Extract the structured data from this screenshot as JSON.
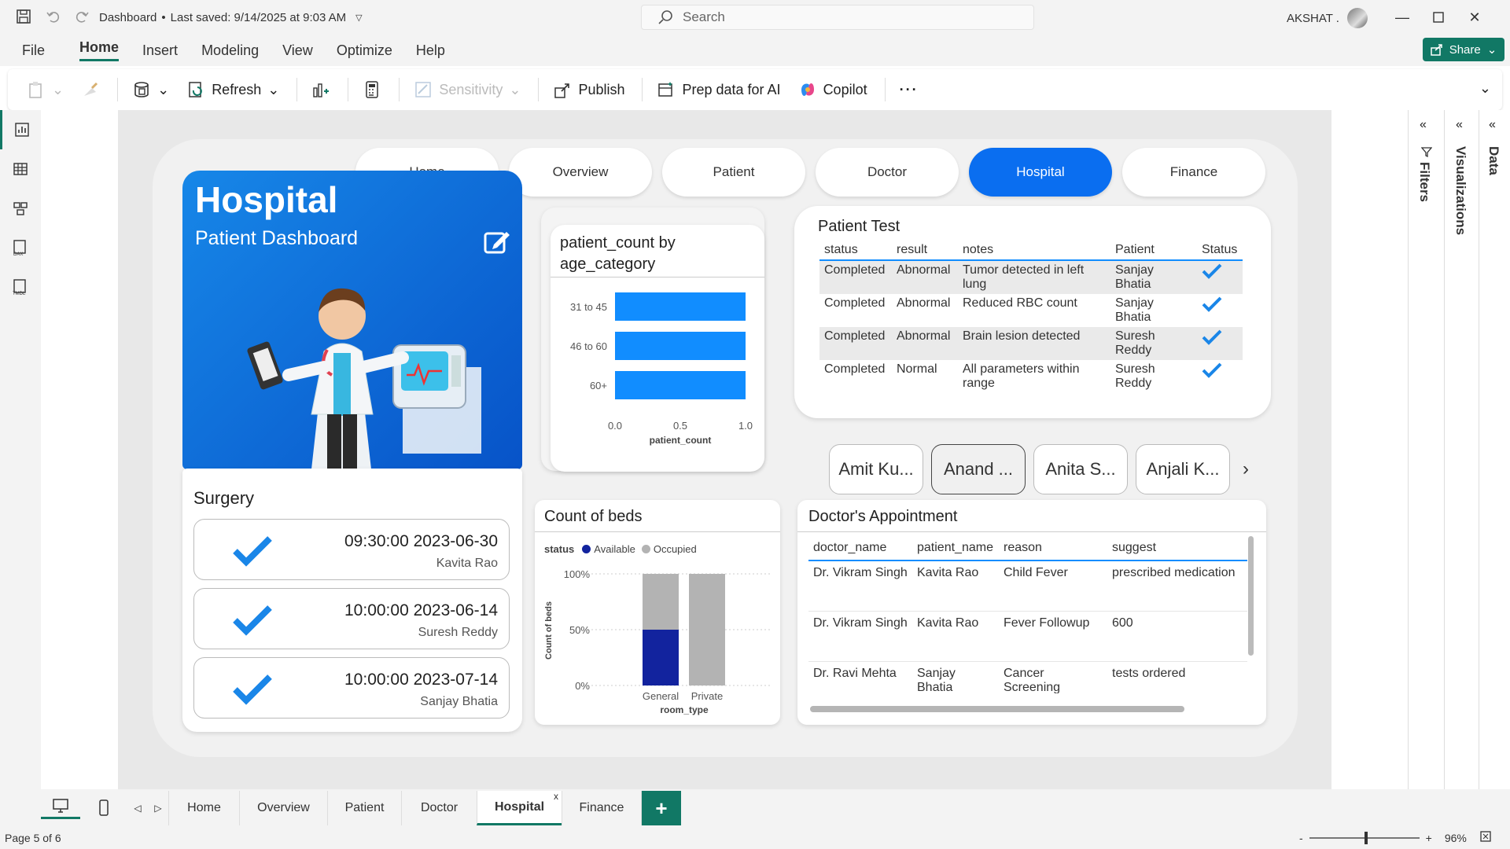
{
  "titlebar": {
    "file": "Dashboard",
    "saved": "Last saved: 9/14/2025 at 9:03 AM",
    "search": "Search",
    "user": "AKSHAT ."
  },
  "menu": [
    "File",
    "Home",
    "Insert",
    "Modeling",
    "View",
    "Optimize",
    "Help"
  ],
  "share": "Share",
  "ribbon": {
    "refresh": "Refresh",
    "sensitivity": "Sensitivity",
    "publish": "Publish",
    "prep": "Prep data for AI",
    "copilot": "Copilot"
  },
  "nav": [
    "Home",
    "Overview",
    "Patient",
    "Doctor",
    "Hospital",
    "Finance"
  ],
  "hero": {
    "title": "Hospital",
    "subtitle": "Patient Dashboard"
  },
  "surgery": {
    "title": "Surgery",
    "items": [
      {
        "time": "09:30:00 2023-06-30",
        "name": "Kavita Rao"
      },
      {
        "time": "10:00:00 2023-06-14",
        "name": "Suresh Reddy"
      },
      {
        "time": "10:00:00 2023-07-14",
        "name": "Sanjay Bhatia"
      }
    ]
  },
  "age_chart": {
    "title_line1": "patient_count by",
    "title_line2": "age_category",
    "xlabel": "patient_count",
    "ticks": [
      "0.0",
      "0.5",
      "1.0"
    ]
  },
  "beds_chart": {
    "title": "Count of beds",
    "legend_title": "status",
    "legend_available": "Available",
    "legend_occupied": "Occupied",
    "ylabel": "Count of beds",
    "xlabel": "room_type",
    "yticks": [
      "100%",
      "50%",
      "0%"
    ]
  },
  "chart_data": [
    {
      "type": "bar",
      "title": "patient_count by age_category",
      "categories": [
        "31 to 45",
        "46 to 60",
        "60+"
      ],
      "values": [
        1,
        1,
        1
      ],
      "xlabel": "patient_count",
      "xlim": [
        0,
        1
      ]
    },
    {
      "type": "bar",
      "title": "Count of beds",
      "categories": [
        "General",
        "Private"
      ],
      "series": [
        {
          "name": "Available",
          "values": [
            50,
            0
          ]
        },
        {
          "name": "Occupied",
          "values": [
            50,
            100
          ]
        }
      ],
      "xlabel": "room_type",
      "ylabel": "Count of beds",
      "ylim": [
        0,
        100
      ]
    }
  ],
  "patient_test": {
    "title": "Patient Test",
    "headers": [
      "status",
      "result",
      "notes",
      "Patient",
      "Status"
    ],
    "rows": [
      [
        "Completed",
        "Abnormal",
        "Tumor detected in left lung",
        "Sanjay Bhatia"
      ],
      [
        "Completed",
        "Abnormal",
        "Reduced RBC count",
        "Sanjay Bhatia"
      ],
      [
        "Completed",
        "Abnormal",
        "Brain lesion detected",
        "Suresh Reddy"
      ],
      [
        "Completed",
        "Normal",
        "All parameters within range",
        "Suresh Reddy"
      ]
    ]
  },
  "doctors": [
    "Amit Ku...",
    "Anand ...",
    "Anita S...",
    "Anjali K..."
  ],
  "appointment": {
    "title": "Doctor's Appointment",
    "headers": [
      "doctor_name",
      "patient_name",
      "reason",
      "suggest"
    ],
    "rows": [
      [
        "Dr. Vikram Singh",
        "Kavita Rao",
        "Child Fever",
        "prescribed medication"
      ],
      [
        "Dr. Vikram Singh",
        "Kavita Rao",
        "Fever Followup",
        "600"
      ],
      [
        "Dr. Ravi Mehta",
        "Sanjay Bhatia",
        "Cancer Screening",
        "tests ordered"
      ]
    ]
  },
  "panes": {
    "filters": "Filters",
    "visualizations": "Visualizations",
    "data": "Data"
  },
  "tabs": [
    "Home",
    "Overview",
    "Patient",
    "Doctor",
    "Hospital",
    "Finance"
  ],
  "status": {
    "page": "Page 5 of 6",
    "zoom": "96%"
  },
  "colors": {
    "accent": "#117865",
    "nav_active": "#0a6ef0",
    "bar": "#118dff",
    "available": "#12239e",
    "occupied": "#b3b3b3"
  }
}
